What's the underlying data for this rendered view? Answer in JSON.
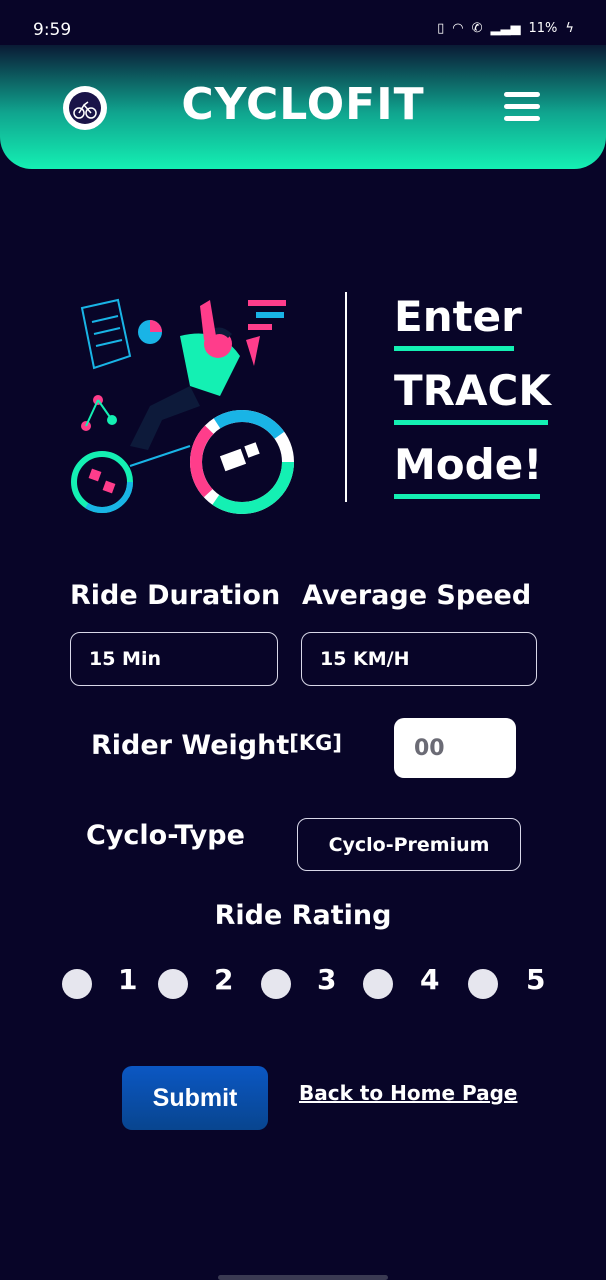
{
  "status_bar": {
    "time": "9:59",
    "battery": "11%"
  },
  "header": {
    "title": "CYCLOFIT"
  },
  "hero": {
    "line1": "Enter",
    "line2": "TRACK",
    "line3": "Mode!"
  },
  "form": {
    "ride_duration": {
      "label": "Ride Duration",
      "value": "15 Min"
    },
    "average_speed": {
      "label": "Average Speed",
      "value": "15 KM/H"
    },
    "rider_weight": {
      "label": "Rider Weight",
      "unit": "[KG]",
      "placeholder": "00"
    },
    "cyclo_type": {
      "label": "Cyclo-Type",
      "value": "Cyclo-Premium"
    },
    "ride_rating": {
      "label": "Ride Rating",
      "options": [
        "1",
        "2",
        "3",
        "4",
        "5"
      ]
    }
  },
  "actions": {
    "submit_label": "Submit",
    "back_link": "Back to Home Page"
  },
  "colors": {
    "background": "#080528",
    "accent": "#14f0b3",
    "pink": "#ff3d8b",
    "blue": "#19b4e6",
    "button": "#0b57c3"
  }
}
